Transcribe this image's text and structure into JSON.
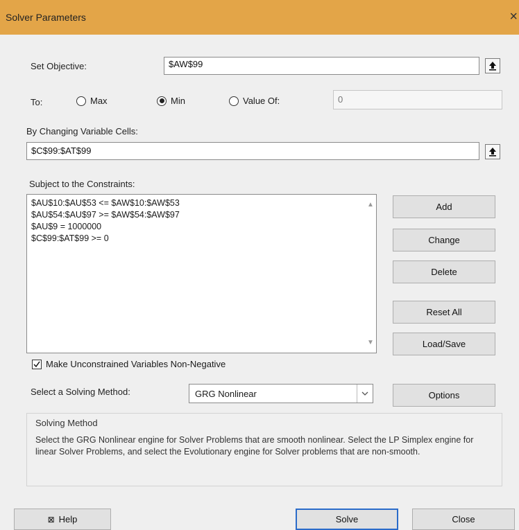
{
  "window": {
    "title": "Solver Parameters",
    "close_glyph": "×"
  },
  "objective": {
    "label": "Set Objective:",
    "value": "$AW$99"
  },
  "to": {
    "label": "To:",
    "options": [
      {
        "label": "Max",
        "selected": false
      },
      {
        "label": "Min",
        "selected": true
      },
      {
        "label": "Value Of:",
        "selected": false
      }
    ],
    "value_of": "0"
  },
  "variables": {
    "label": "By Changing Variable Cells:",
    "value": "$C$99:$AT$99"
  },
  "constraints": {
    "label": "Subject to the Constraints:",
    "items": [
      "$AU$10:$AU$53 <= $AW$10:$AW$53",
      "$AU$54:$AU$97 >= $AW$54:$AW$97",
      "$AU$9 = 1000000",
      "$C$99:$AT$99 >= 0"
    ]
  },
  "buttons": {
    "add": "Add",
    "change": "Change",
    "delete": "Delete",
    "reset_all": "Reset All",
    "load_save": "Load/Save",
    "options": "Options",
    "help": "Help",
    "solve": "Solve",
    "close": "Close"
  },
  "nonneg": {
    "label": "Make Unconstrained Variables Non-Negative",
    "checked": true
  },
  "method": {
    "label": "Select a Solving Method:",
    "value": "GRG Nonlinear"
  },
  "solving_method": {
    "title": "Solving Method",
    "text": "Select the GRG Nonlinear engine for Solver Problems that are smooth nonlinear. Select the LP Simplex engine for linear Solver Problems, and select the Evolutionary engine for Solver problems that are non-smooth."
  },
  "colors": {
    "titlebar": "#e3a548",
    "solve_border": "#2a6bc9"
  }
}
